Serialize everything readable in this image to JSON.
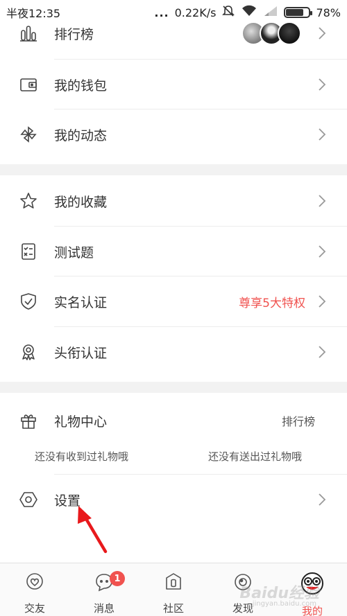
{
  "status_bar": {
    "time": "半夜12:35",
    "net_speed": "0.22K/s",
    "battery": "78%",
    "battery_level": 0.78,
    "dots": "..."
  },
  "menu": {
    "ranking": {
      "label": "排行榜",
      "icon": "bar-chart-icon"
    },
    "wallet": {
      "label": "我的钱包",
      "icon": "wallet-icon"
    },
    "dynamics": {
      "label": "我的动态",
      "icon": "pinwheel-icon"
    },
    "favorites": {
      "label": "我的收藏",
      "icon": "star-icon"
    },
    "quiz": {
      "label": "测试题",
      "icon": "checklist-icon"
    },
    "realname": {
      "label": "实名认证",
      "extra": "尊享5大特权",
      "icon": "shield-check-icon"
    },
    "title_cert": {
      "label": "头衔认证",
      "icon": "medal-icon"
    },
    "gift": {
      "label": "礼物中心",
      "extra": "排行榜",
      "received": "还没有收到过礼物哦",
      "sent": "还没有送出过礼物哦",
      "icon": "gift-icon"
    },
    "settings": {
      "label": "设置",
      "icon": "hexagon-settings-icon"
    }
  },
  "tabbar": {
    "tabs": [
      {
        "label": "交友",
        "icon": "heart-chat-icon",
        "active": false
      },
      {
        "label": "消息",
        "icon": "message-icon",
        "badge": "1",
        "active": false
      },
      {
        "label": "社区",
        "icon": "community-icon",
        "active": false
      },
      {
        "label": "发现",
        "icon": "discover-icon",
        "active": false
      },
      {
        "label": "我的",
        "icon": "profile-avatar-icon",
        "active": true
      }
    ]
  },
  "watermark": {
    "text": "Baidu经验",
    "sub": "jingyan.baidu.com"
  },
  "colors": {
    "accent": "#f0524f",
    "gap": "#f2f2f2",
    "divider": "#ececec"
  }
}
